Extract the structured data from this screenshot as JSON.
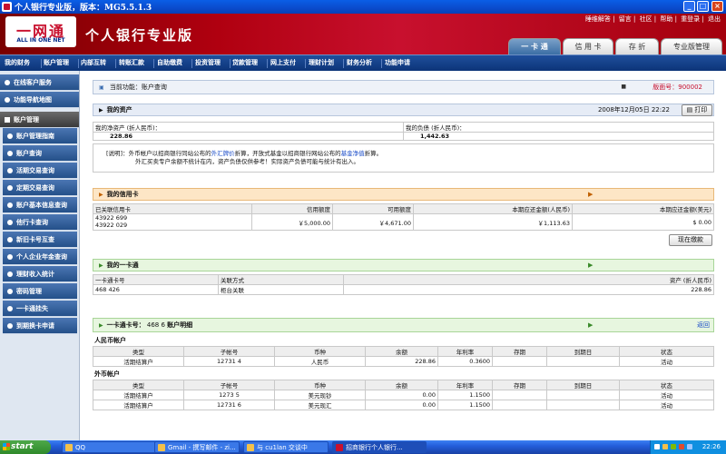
{
  "window": {
    "title": "个人银行专业版，版本：MG5.5.1.3",
    "buttons": {
      "minimize": "_",
      "maximize": "□",
      "close": "×"
    }
  },
  "header": {
    "logo_cn": "一网通",
    "logo_en": "ALL IN ONE NET",
    "brand": "个人银行专业版",
    "top_links": [
      "睡维解答",
      "留言",
      "社区",
      "帮助",
      "重登录",
      "退出"
    ],
    "tabs": [
      {
        "label": "一 卡 通",
        "active": true
      },
      {
        "label": "信 用 卡",
        "active": false
      },
      {
        "label": "存 折",
        "active": false
      },
      {
        "label": "专业版管理",
        "active": false
      }
    ]
  },
  "menu": [
    "我的财务",
    "账户管理",
    "内部互转",
    "转账汇款",
    "自助缴费",
    "投资管理",
    "贷款管理",
    "网上支付",
    "理财计划",
    "财务分析",
    "功能申请"
  ],
  "sidebar": {
    "top": [
      "在线客户服务",
      "功能导航地图"
    ],
    "section": "账户管理",
    "items": [
      "账户管理指南",
      "账户查询",
      "活期交易查询",
      "定期交易查询",
      "账户基本信息查询",
      "他行卡查询",
      "新旧卡号互查",
      "个人企业年金查询",
      "理财收入统计",
      "密码管理",
      "一卡通挂失",
      "到期换卡申请"
    ]
  },
  "content": {
    "breadcrumb": "当前功能：账户查询",
    "version": "版面号：900002",
    "assets": {
      "title": "我的资产",
      "datetime": "2008年12月05日 22:22",
      "print_label": "打印",
      "net_label": "我的净资产 (折人民币)：",
      "net_value": "228.86",
      "debt_label": "我的负债 (折人民币)：",
      "debt_value": "1,442.63",
      "note_line1_a": "[说明]：外币帐户以招商银行同站公布的",
      "note_line1_link1": "外汇牌价",
      "note_line1_b": "折算，开放式基金以招商银行网站公布的",
      "note_line1_link2": "基金净值",
      "note_line1_c": "折算。",
      "note_line2": "外汇买卖专户余额不统计在内，资产负债仅供参考！实际资产负债可能与统计有出入。"
    },
    "credit": {
      "title": "我的信用卡",
      "headers": [
        "已关联信用卡",
        "信用额度",
        "可用额度",
        "本期应还金额(人民币)",
        "本期应还金额(美元)"
      ],
      "cards": [
        "43922        699",
        "43922        029"
      ],
      "credit_limit": "￥5,000.00",
      "available": "￥4,671.00",
      "due_rmb": "￥1,113.63",
      "due_usd": "$ 0.00",
      "repay_button": "现在缴款"
    },
    "onecard": {
      "title": "我的一卡通",
      "headers": [
        "一卡通卡号",
        "关联方式",
        "资产 (折人民币)"
      ],
      "row": [
        "468              426",
        "柜台关联",
        "228.86"
      ]
    },
    "detail": {
      "title_label": "一卡通卡号：",
      "card_no": "468                   6",
      "title_suffix": "账户明细",
      "back": "返回",
      "rmb_title": "人民币帐户",
      "fx_title": "外币帐户",
      "headers": [
        "类型",
        "子帐号",
        "币种",
        "余额",
        "年利率",
        "存期",
        "到期日",
        "状态"
      ],
      "rmb_rows": [
        [
          "活期结算户",
          "12731         4",
          "人民币",
          "228.86",
          "0.3600",
          "",
          "",
          "活动"
        ]
      ],
      "fx_rows": [
        [
          "活期结算户",
          "1273          5",
          "美元现钞",
          "0.00",
          "1.1500",
          "",
          "",
          "活动"
        ],
        [
          "活期结算户",
          "12731         6",
          "美元现汇",
          "0.00",
          "1.1500",
          "",
          "",
          "活动"
        ]
      ]
    }
  },
  "taskbar": {
    "start": "start",
    "tasks": [
      {
        "label": "QQ",
        "active": false
      },
      {
        "label": "Gmail - 撰写邮件 - zi...",
        "active": false
      },
      {
        "label": "与 cu1lan 交谈中",
        "active": false
      },
      {
        "label": "招商银行个人银行...",
        "active": true
      }
    ],
    "clock": "22:26"
  },
  "colors": {
    "header_red": "#c8102e",
    "menu_blue": "#0c3478",
    "assets_bar": "#e6ecf6",
    "credit_bar": "#fde6c6",
    "onecard_bar": "#e7f6df"
  }
}
